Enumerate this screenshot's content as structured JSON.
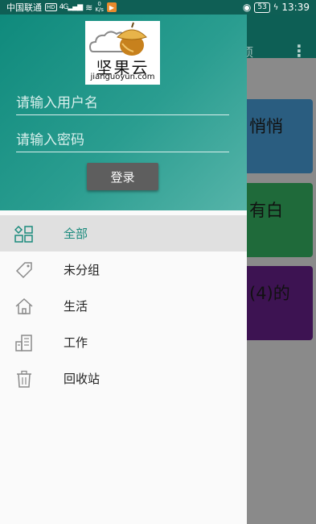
{
  "status_bar": {
    "carrier": "中国联通",
    "hd": "HD",
    "signal": "4G",
    "speed_value": "0",
    "speed_unit": "K/s",
    "battery": "53",
    "time": "13:39"
  },
  "background": {
    "toolbar_title": "项",
    "menu_icon": "more-vert-icon",
    "cards": [
      {
        "text": "悄悄",
        "color": "#2a5d80"
      },
      {
        "text": "有白",
        "color": "#1f6a3a"
      },
      {
        "text": "(4)的",
        "color": "#3d1352"
      }
    ]
  },
  "drawer": {
    "logo": {
      "name": "坚果云",
      "domain": "jianguoyun.com"
    },
    "username_placeholder": "请输入用户名",
    "password_placeholder": "请输入密码",
    "login_label": "登录",
    "nav_items": [
      {
        "label": "全部",
        "icon": "grid-icon",
        "active": true
      },
      {
        "label": "未分组",
        "icon": "tag-icon",
        "active": false
      },
      {
        "label": "生活",
        "icon": "home-icon",
        "active": false
      },
      {
        "label": "工作",
        "icon": "office-building-icon",
        "active": false
      },
      {
        "label": "回收站",
        "icon": "trash-icon",
        "active": false
      }
    ],
    "accent_color": "#1a8a7c"
  }
}
